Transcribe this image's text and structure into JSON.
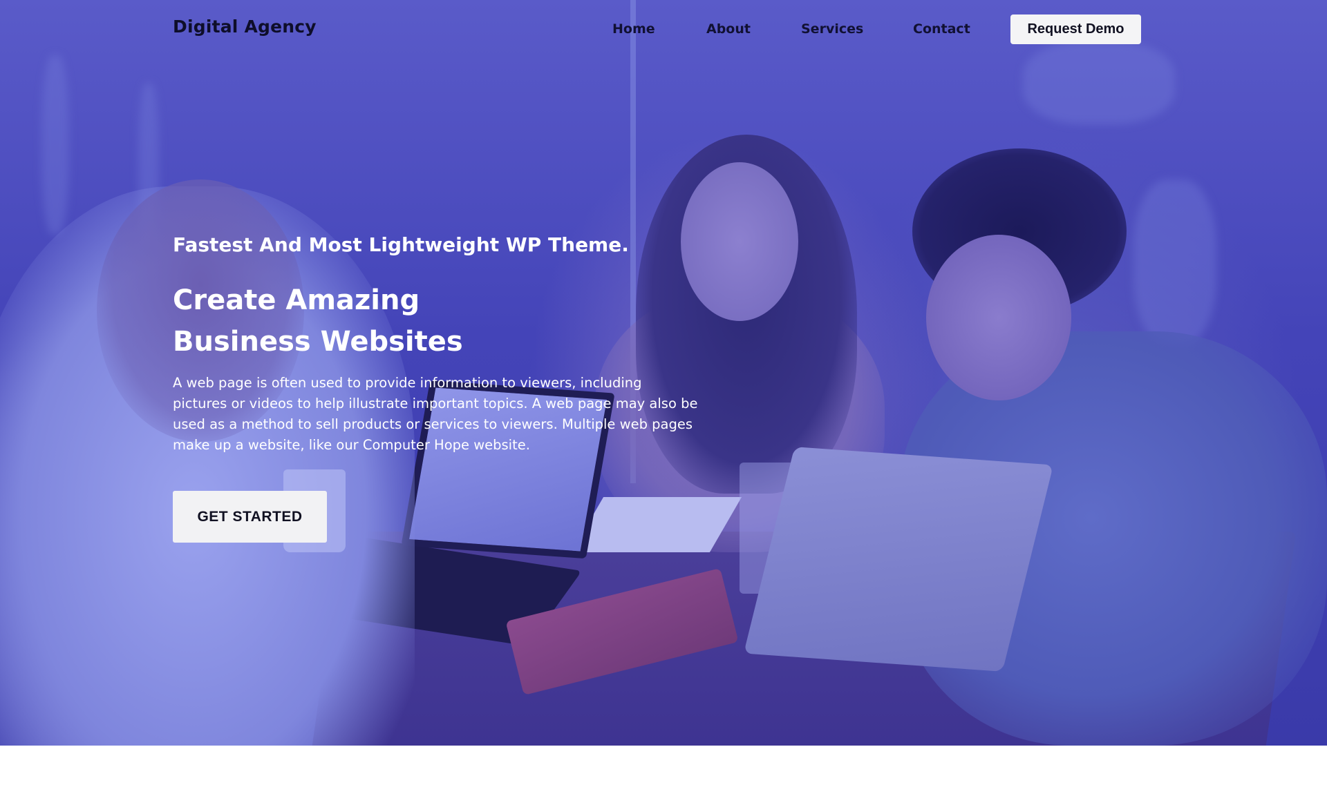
{
  "nav": {
    "brand": "Digital Agency",
    "links": [
      "Home",
      "About",
      "Services",
      "Contact"
    ],
    "demo_label": "Request Demo"
  },
  "hero": {
    "tagline": "Fastest And Most Lightweight WP Theme.",
    "headline_line1": "Create Amazing",
    "headline_line2": "Business Websites",
    "description": "A web page is often used to provide information to viewers, including pictures or videos to help illustrate important topics. A web page may also be used as a method to sell products or services to viewers. Multiple web pages make up a website, like our Computer Hope website.",
    "cta_label": "GET STARTED",
    "overlay_color": "#4b4cc6"
  }
}
